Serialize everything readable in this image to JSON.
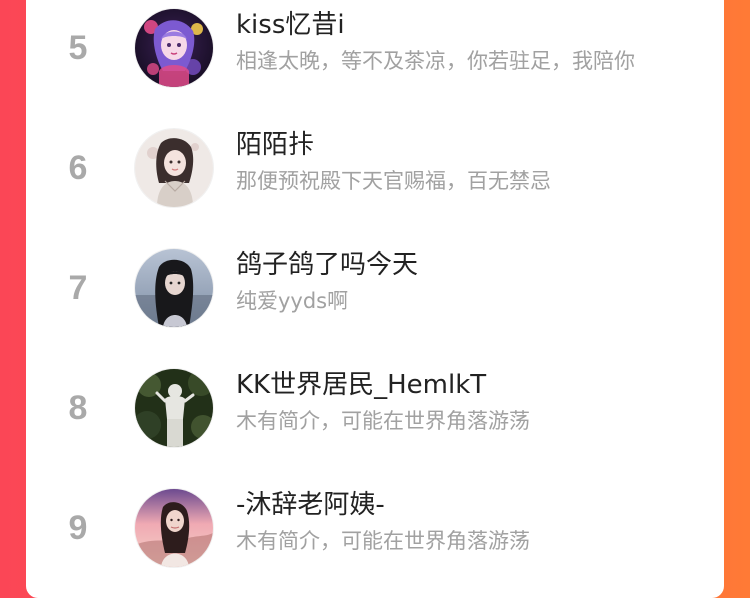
{
  "ranking": {
    "entries": [
      {
        "rank": "5",
        "nickname": "kiss忆昔i",
        "bio": "相逢太晚，等不及茶凉，你若驻足，我陪你",
        "avatar_icon": "anime-girl-avatar",
        "avatar_colors": [
          "#241437",
          "#6e48b5",
          "#f6d8e8",
          "#e24b8a"
        ]
      },
      {
        "rank": "6",
        "nickname": "陌陌拤",
        "bio": "那便预祝殿下天官赐福，百无禁忌",
        "avatar_icon": "illustrated-girl-avatar",
        "avatar_colors": [
          "#efe9e6",
          "#3b2e2d",
          "#d8cfc8",
          "#f4d8d2"
        ]
      },
      {
        "rank": "7",
        "nickname": "鸽子鸽了吗今天",
        "bio": "纯爱yyds啊",
        "avatar_icon": "portrait-photo-avatar",
        "avatar_colors": [
          "#7f8fa5",
          "#18181b",
          "#c7c8d3",
          "#b8c3d4"
        ]
      },
      {
        "rank": "8",
        "nickname": "KK世界居民_HemlkT",
        "bio": "木有简介，可能在世界角落游荡",
        "avatar_icon": "statue-photo-avatar",
        "avatar_colors": [
          "#223018",
          "#4f6339",
          "#e6e6e1",
          "#1d2616"
        ]
      },
      {
        "rank": "9",
        "nickname": "-沐辞老阿姨-",
        "bio": "木有简介，可能在世界角落游荡",
        "avatar_icon": "sunset-portrait-avatar",
        "avatar_colors": [
          "#f0aab3",
          "#6c4a8f",
          "#2d1c1c",
          "#f4d3c8"
        ]
      }
    ]
  }
}
